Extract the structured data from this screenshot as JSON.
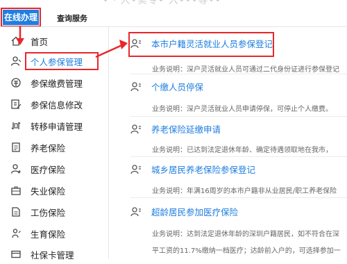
{
  "top": {
    "faint_title": "• · 人•实专• 入•••等••",
    "tabs": [
      {
        "label": "在线办理",
        "active": true
      },
      {
        "label": "查询服务",
        "active": false
      }
    ]
  },
  "sidebar": {
    "items": [
      {
        "label": "首页",
        "icon": "home-icon"
      },
      {
        "label": "个人参保管理",
        "icon": "person-icon",
        "active": true
      },
      {
        "label": "参保缴费管理",
        "icon": "coin-icon"
      },
      {
        "label": "参保信息修改",
        "icon": "edit-icon"
      },
      {
        "label": "转移申请管理",
        "icon": "transfer-icon"
      },
      {
        "label": "养老保险",
        "icon": "document-icon"
      },
      {
        "label": "医疗保险",
        "icon": "medical-person-icon"
      },
      {
        "label": "失业保险",
        "icon": "briefcase-icon"
      },
      {
        "label": "工伤保险",
        "icon": "file-icon"
      },
      {
        "label": "生育保险",
        "icon": "baby-icon"
      },
      {
        "label": "社保卡管理",
        "icon": "card-icon"
      }
    ]
  },
  "services": [
    {
      "title": "本市户籍灵活就业人员参保登记",
      "desc": "业务说明：深户灵活就业人员可通过二代身份证进行参保登记"
    },
    {
      "title": "个缴人员停保",
      "desc": "业务说明：深户灵活就业人员申请停保，可停止个人缴费。"
    },
    {
      "title": "养老保险延缴申请",
      "desc": "业务说明：已达到法定退休年龄、确定待遇领取地在我市，"
    },
    {
      "title": "城乡居民养老保险参保登记",
      "desc": "业务说明：年满16周岁的本市户籍非从业居民/职工养老保险"
    },
    {
      "title": "超龄居民参加医疗保险",
      "desc": "业务说明：达到法定退休年龄的深圳户籍居民，如不符合在深",
      "desc2": "平工资的11.7%缴纳一档医疗；达龄前入户的，可选择参加一"
    }
  ],
  "colors": {
    "accent": "#1f7ee0",
    "highlight": "#e8262b"
  }
}
